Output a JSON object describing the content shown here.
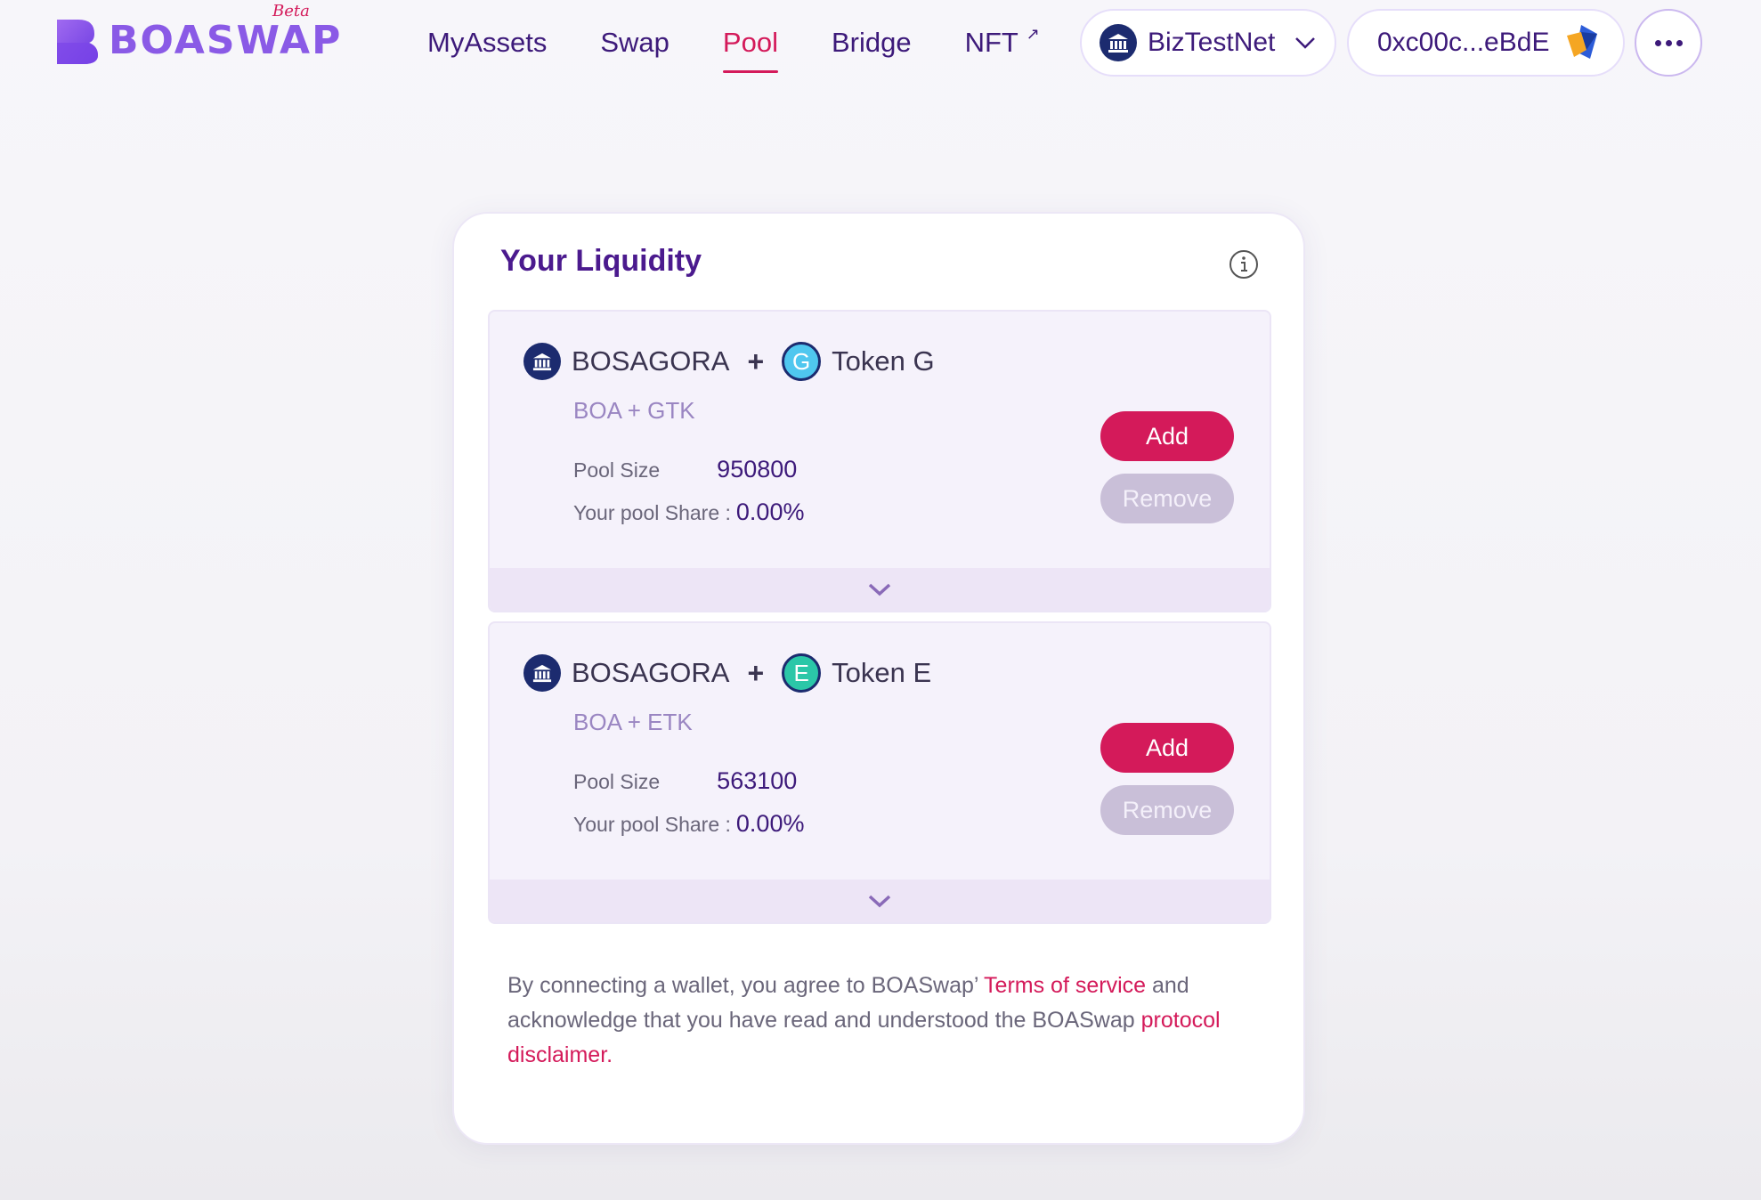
{
  "header": {
    "logo_text": "BOASWAP",
    "logo_badge": "Beta",
    "nav": [
      {
        "label": "MyAssets",
        "active": false
      },
      {
        "label": "Swap",
        "active": false
      },
      {
        "label": "Pool",
        "active": true
      },
      {
        "label": "Bridge",
        "active": false
      },
      {
        "label": "NFT",
        "active": false,
        "external": true
      }
    ],
    "network": {
      "label": "BizTestNet",
      "icon": "bank-icon"
    },
    "account": {
      "label": "0xc00c...eBdE",
      "icon": "wallet-avatar-icon"
    },
    "more_icon": "more-dots-icon"
  },
  "liquidity": {
    "title": "Your Liquidity",
    "info_icon": "info-icon",
    "pools": [
      {
        "token_a": "BOSAGORA",
        "token_b": "Token G",
        "token_b_letter": "G",
        "plus": "+",
        "pair_symbol": "BOA + GTK",
        "pool_size_label": "Pool Size",
        "pool_size": "950800",
        "share_label": "Your pool Share :",
        "share": "0.00%",
        "add_label": "Add",
        "remove_label": "Remove"
      },
      {
        "token_a": "BOSAGORA",
        "token_b": "Token E",
        "token_b_letter": "E",
        "plus": "+",
        "pair_symbol": "BOA + ETK",
        "pool_size_label": "Pool Size",
        "pool_size": "563100",
        "share_label": "Your pool Share :",
        "share": "0.00%",
        "add_label": "Add",
        "remove_label": "Remove"
      }
    ]
  },
  "footer": {
    "text_1": "By connecting a wallet, you agree to BOASwap’ ",
    "terms_link": "Terms of service",
    "text_2": " and acknowledge that you have read and understood the BOASwap ",
    "disclaimer_link": "protocol disclaimer."
  },
  "colors": {
    "accent": "#d41a5a",
    "primary_text": "#3d1a7a",
    "network_icon_bg": "#1c2b6f"
  }
}
